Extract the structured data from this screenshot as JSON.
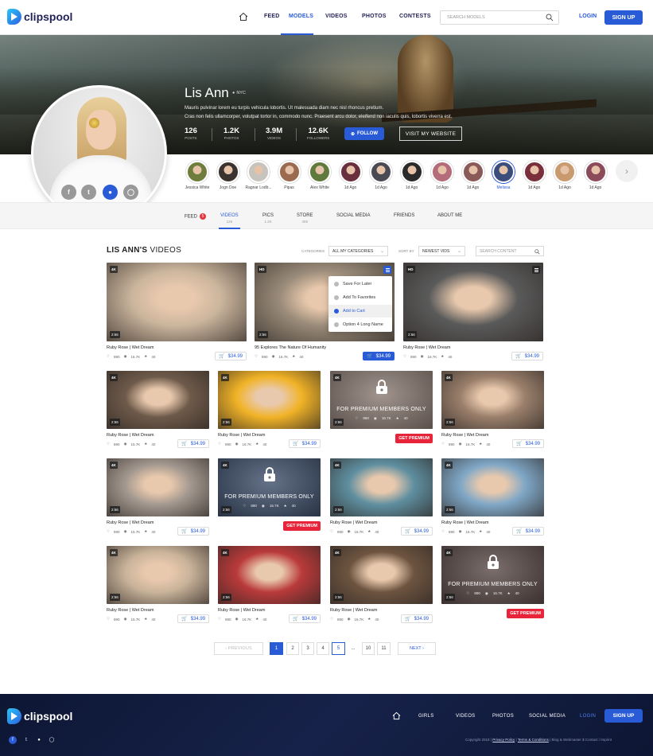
{
  "header": {
    "logo": "clipspool",
    "nav": [
      "FEED",
      "MODELS",
      "VIDEOS",
      "PHOTOS",
      "CONTESTS"
    ],
    "active_nav": "MODELS",
    "search_placeholder": "SEARCH MODELS",
    "login": "LOGIN",
    "signup": "SIGN UP"
  },
  "profile": {
    "name": "Lis Ann",
    "location": "NYC",
    "bio_line1": "Mauris pulvinar lorem eu turpis vehicula lobortis. Ut malesuada diam nec nisl rhoncus pretium.",
    "bio_line2": "Cras non felis ullamcorper, volutpat tortor in, commodo nunc. Praesent arcu dolor, eleifend non iaculis quis, lobortis viverra est.",
    "stats": [
      {
        "value": "126",
        "label": "POSTS"
      },
      {
        "value": "1.2K",
        "label": "PHOTOS"
      },
      {
        "value": "3.9M",
        "label": "VIDEOS"
      },
      {
        "value": "12.6K",
        "label": "FOLLOWERS"
      }
    ],
    "follow": "FOLLOW",
    "website": "VISIT MY WEBSITE",
    "social": [
      "f",
      "t",
      "bell",
      "ig"
    ]
  },
  "friends": [
    {
      "name": "Jessica White",
      "color": "#6f7d3c"
    },
    {
      "name": "Jogn Doe",
      "color": "#3a3330"
    },
    {
      "name": "Ragnar Lodb...",
      "color": "#c7c3bd"
    },
    {
      "name": "Pipas",
      "color": "#9a6b4f"
    },
    {
      "name": "Alex White",
      "color": "#5f7a3c"
    },
    {
      "name": "1d Ago",
      "color": "#6a2f3e"
    },
    {
      "name": "1d Ago",
      "color": "#4a4a55"
    },
    {
      "name": "1d Ago",
      "color": "#2a2a2a"
    },
    {
      "name": "1d Ago",
      "color": "#b46c7a"
    },
    {
      "name": "1d Ago",
      "color": "#8a5a58"
    },
    {
      "name": "Melissa",
      "color": "#3b4d7a"
    },
    {
      "name": "1d Ago",
      "color": "#7a2f3a"
    },
    {
      "name": "1d Ago",
      "color": "#c99a6e"
    },
    {
      "name": "1d Ago",
      "color": "#8c4b5a"
    }
  ],
  "tabs": [
    {
      "label": "FEED",
      "sub": "",
      "badge": "5"
    },
    {
      "label": "VIDEOS",
      "sub": "126"
    },
    {
      "label": "PICS",
      "sub": "1.2K"
    },
    {
      "label": "STORE",
      "sub": "455"
    },
    {
      "label": "SOCIAL MEDIA",
      "sub": ""
    },
    {
      "label": "FRIENDS",
      "sub": ""
    },
    {
      "label": "ABOUT ME",
      "sub": ""
    }
  ],
  "videos_section": {
    "title_bold": "LIS ANN'S",
    "title_rest": " VIDEOS",
    "categories_label": "CATEGORIES",
    "categories_value": "ALL MY CATEGORIES",
    "sort_label": "SORT BY",
    "sort_value": "NEWEST VIDS",
    "search_placeholder": "SEARCH CONTENT"
  },
  "dropdown": [
    "Save For Later",
    "Add To Favorites",
    "Add to Cart",
    "Option 4 Long Name"
  ],
  "videos": [
    {
      "quality": "4K",
      "duration": "2:56",
      "title": "Ruby Rose | Wet Dream",
      "likes": "890",
      "views": "16.7K",
      "stars": "40",
      "price": "$34.99",
      "bg": "#cbb59d"
    },
    {
      "quality": "HD",
      "duration": "2:56",
      "title": "95 Explores The Nature Of Humanity",
      "likes": "890",
      "views": "16.7K",
      "stars": "40",
      "price": "$34.99",
      "bg": "#9b8c7a"
    },
    {
      "quality": "HD",
      "duration": "2:56",
      "title": "Ruby Rose | Wet Dream",
      "likes": "890",
      "views": "16.7K",
      "stars": "40",
      "price": "$34.99",
      "bg": "#5a5a5a"
    },
    {
      "quality": "4K",
      "duration": "2:56",
      "title": "Ruby Rose | Wet Dream",
      "likes": "890",
      "views": "16.7K",
      "stars": "40",
      "price": "$34.99",
      "bg": "#6e5a4a"
    },
    {
      "quality": "4K",
      "duration": "2:56",
      "title": "Ruby Rose | Wet Dream",
      "likes": "890",
      "views": "16.7K",
      "stars": "40",
      "price": "$34.99",
      "bg": "#f1b327"
    },
    {
      "quality": "4K",
      "duration": "2:56",
      "premium": true,
      "premium_text": "FOR PREMIUM MEMBERS ONLY",
      "likes": "890",
      "views": "16.7K",
      "stars": "40",
      "get_premium": "GET PREMIUM",
      "bg": "#8a7a72"
    },
    {
      "quality": "4K",
      "duration": "2:56",
      "title": "Ruby Rose | Wet Dream",
      "likes": "890",
      "views": "16.7K",
      "stars": "40",
      "price": "$34.99",
      "bg": "#9a7f6b"
    },
    {
      "quality": "4K",
      "duration": "2:56",
      "title": "Ruby Rose | Wet Dream",
      "likes": "890",
      "views": "16.7K",
      "stars": "40",
      "price": "$34.99",
      "bg": "#a3988f"
    },
    {
      "quality": "4K",
      "duration": "2:56",
      "premium": true,
      "premium_text": "FOR PREMIUM MEMBERS ONLY",
      "likes": "890",
      "views": "16.7K",
      "stars": "40",
      "get_premium": "GET PREMIUM",
      "bg": "#3e4f6a"
    },
    {
      "quality": "4K",
      "duration": "2:56",
      "title": "Ruby Rose | Wet Dream",
      "likes": "890",
      "views": "16.7K",
      "stars": "40",
      "price": "$34.99",
      "bg": "#5f8fa0"
    },
    {
      "quality": "4K",
      "duration": "2:56",
      "title": "Ruby Rose | Wet Dream",
      "likes": "890",
      "views": "16.7K",
      "stars": "40",
      "price": "$34.99",
      "bg": "#7fa7c6"
    },
    {
      "quality": "4K",
      "duration": "2:56",
      "title": "Ruby Rose | Wet Dream",
      "likes": "890",
      "views": "16.7K",
      "stars": "40",
      "price": "$34.99",
      "bg": "#c9b39a"
    },
    {
      "quality": "4K",
      "duration": "2:56",
      "title": "Ruby Rose | Wet Dream",
      "likes": "890",
      "views": "16.7K",
      "stars": "40",
      "price": "$34.99",
      "bg": "#b93a3a"
    },
    {
      "quality": "4K",
      "duration": "2:56",
      "title": "Ruby Rose | Wet Dream",
      "likes": "890",
      "views": "16.7K",
      "stars": "40",
      "price": "$34.99",
      "bg": "#6d5440"
    },
    {
      "quality": "4K",
      "duration": "2:56",
      "premium": true,
      "premium_text": "FOR PREMIUM MEMBERS ONLY",
      "likes": "890",
      "views": "16.7K",
      "stars": "40",
      "get_premium": "GET PREMIUM",
      "bg": "#5a4a48"
    }
  ],
  "pagination": {
    "previous": "PREVIOUS",
    "pages": [
      "1",
      "2",
      "3",
      "4",
      "5",
      "...",
      "10",
      "11"
    ],
    "active": "1",
    "current": "5",
    "next": "NEXT"
  },
  "footer": {
    "logo": "clipspool",
    "nav": [
      "GIRLS",
      "VIDEOS",
      "PHOTOS",
      "SOCIAL MEDIA",
      "LOGIN"
    ],
    "signup": "SIGN UP",
    "copyright": "Copyright 2018 | ",
    "privacy": "Privacy Policy",
    "sep": " | ",
    "terms": "Terms & Conditions",
    "rest": " | Blog & Webmaster $ Contact / Imprint"
  },
  "colors": {
    "accent": "#2a5bd7",
    "danger": "#e8243a",
    "footer_bg": "#111b3d"
  }
}
